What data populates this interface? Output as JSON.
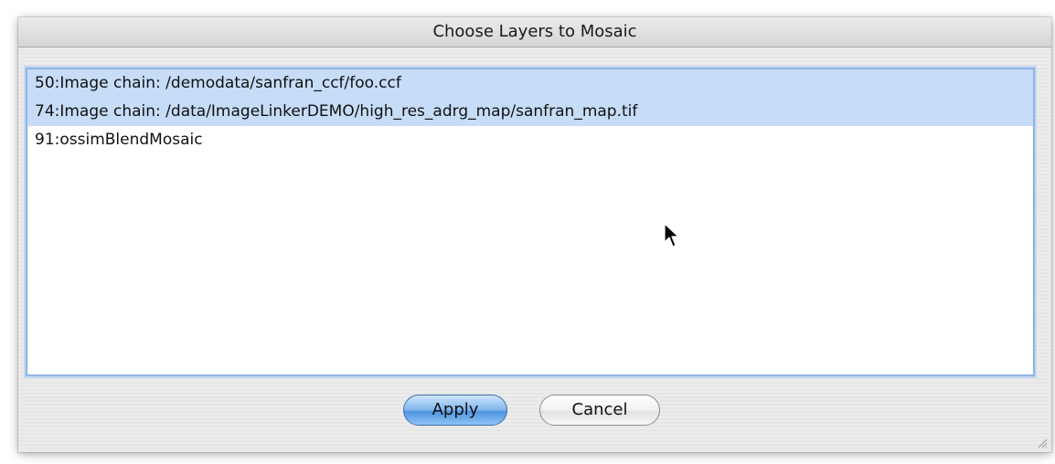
{
  "dialog": {
    "title": "Choose Layers to Mosaic"
  },
  "layers": {
    "items": [
      {
        "label": "50:Image chain: /demodata/sanfran_ccf/foo.ccf",
        "selected": true
      },
      {
        "label": "74:Image chain: /data/ImageLinkerDEMO/high_res_adrg_map/sanfran_map.tif",
        "selected": true
      },
      {
        "label": "91:ossimBlendMosaic",
        "selected": false
      }
    ]
  },
  "buttons": {
    "apply_label": "Apply",
    "cancel_label": "Cancel"
  },
  "colors": {
    "selection": "#c6dcf7",
    "focus_ring": "#8fb4e1",
    "default_button": "#7fb4ec"
  },
  "icons": {
    "cursor": "arrow-cursor-icon",
    "resize": "resize-grip-icon"
  }
}
